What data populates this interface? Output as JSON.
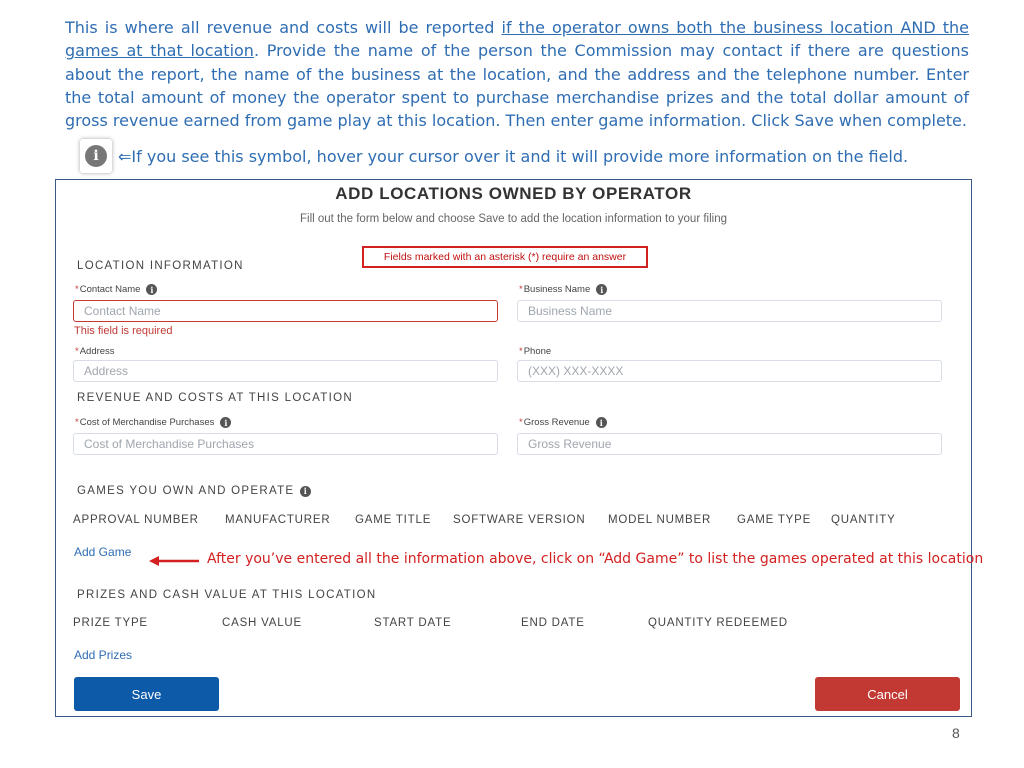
{
  "intro": {
    "text_before": "This is where all revenue and costs will be reported ",
    "text_underlined": "if the operator owns both the business location AND the games at that location",
    "text_after": ". Provide the name of the person the Commission may contact if there are questions about the report, the name of the business at the location, and the address and the telephone number. Enter the total amount of money the operator spent to purchase merchandise prizes and the total dollar amount of gross revenue earned from game play at this location. Then enter game information. Click Save when complete."
  },
  "tip": {
    "icon": "info-icon",
    "glyph": "i",
    "text": "⇐If you see this symbol, hover your cursor over it and it will provide more information on the field."
  },
  "form": {
    "title": "ADD LOCATIONS OWNED BY OPERATOR",
    "subtitle": "Fill out the form below and choose Save to add the location information to your filing",
    "required_note": "Fields marked with an asterisk (*) require an answer",
    "location_section": "LOCATION INFORMATION",
    "contact_name": {
      "label": "Contact Name",
      "placeholder": "Contact Name",
      "error": "This field is required"
    },
    "business_name": {
      "label": "Business Name",
      "placeholder": "Business Name"
    },
    "address": {
      "label": "Address",
      "placeholder": "Address"
    },
    "phone": {
      "label": "Phone",
      "placeholder": "(XXX) XXX-XXXX"
    },
    "revenue_section": "REVENUE AND COSTS AT THIS LOCATION",
    "cost_merch": {
      "label": "Cost of Merchandise Purchases",
      "placeholder": "Cost of Merchandise Purchases"
    },
    "gross_revenue": {
      "label": "Gross Revenue",
      "placeholder": "Gross Revenue"
    },
    "games_section": "GAMES YOU OWN AND OPERATE",
    "games_columns": [
      "APPROVAL NUMBER",
      "MANUFACTURER",
      "GAME TITLE",
      "SOFTWARE VERSION",
      "MODEL NUMBER",
      "GAME TYPE",
      "QUANTITY"
    ],
    "add_game": "Add Game",
    "add_game_note": "After you’ve entered all the information above, click on “Add Game” to list the games operated at this location",
    "prizes_section": "PRIZES AND CASH VALUE AT THIS LOCATION",
    "prizes_columns": [
      "PRIZE TYPE",
      "CASH VALUE",
      "START DATE",
      "END DATE",
      "QUANTITY REDEEMED"
    ],
    "add_prizes": "Add Prizes",
    "save": "Save",
    "cancel": "Cancel"
  },
  "colors": {
    "accent_blue": "#2f6db3",
    "save_blue": "#0c5aa8",
    "cancel_red": "#c23934",
    "note_red": "#d42020"
  },
  "page_number": "8"
}
